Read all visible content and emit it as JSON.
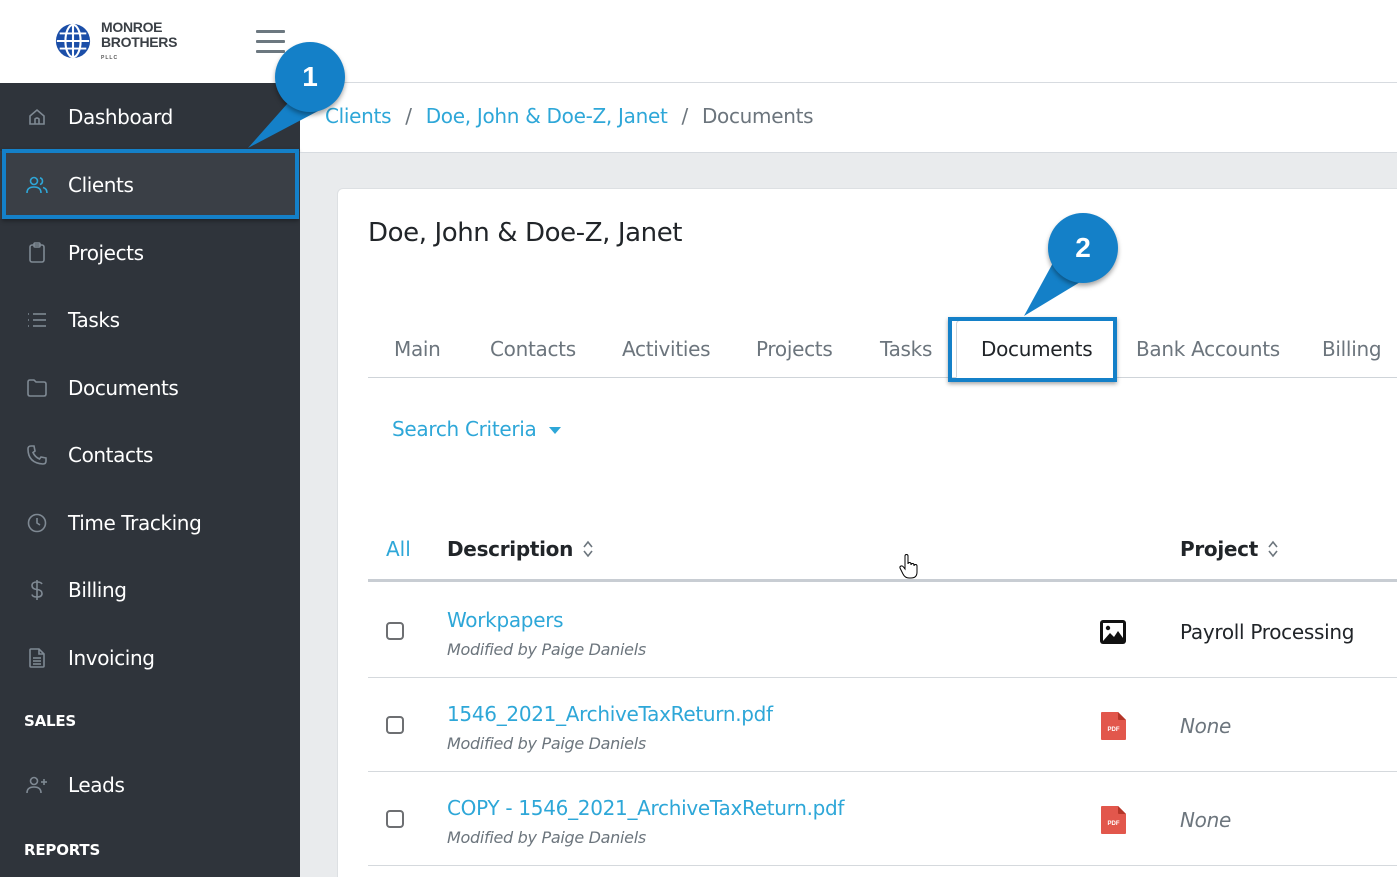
{
  "app": {
    "logo_line1": "MONROE",
    "logo_line2": "BROTHERS",
    "logo_sub": "PLLC",
    "brand_color": "#1b4ea8",
    "accent_color": "#2ea7d8",
    "callout_color": "#1480c8"
  },
  "sidebar": {
    "items": [
      {
        "label": "Dashboard",
        "icon": "home-icon"
      },
      {
        "label": "Clients",
        "icon": "users-icon",
        "active": true
      },
      {
        "label": "Projects",
        "icon": "clipboard-icon"
      },
      {
        "label": "Tasks",
        "icon": "list-icon"
      },
      {
        "label": "Documents",
        "icon": "folder-icon"
      },
      {
        "label": "Contacts",
        "icon": "phone-icon"
      },
      {
        "label": "Time Tracking",
        "icon": "clock-icon"
      },
      {
        "label": "Billing",
        "icon": "dollar-icon"
      },
      {
        "label": "Invoicing",
        "icon": "file-text-icon"
      }
    ],
    "sections": [
      {
        "label": "SALES",
        "items": [
          {
            "label": "Leads",
            "icon": "user-plus-icon"
          }
        ]
      },
      {
        "label": "REPORTS",
        "items": []
      }
    ]
  },
  "breadcrumb": {
    "items": [
      "Clients",
      "Doe, John & Doe-Z, Janet"
    ],
    "current": "Documents",
    "separator": "/"
  },
  "client": {
    "title": "Doe, John & Doe-Z, Janet"
  },
  "tabs": [
    {
      "label": "Main"
    },
    {
      "label": "Contacts"
    },
    {
      "label": "Activities"
    },
    {
      "label": "Projects"
    },
    {
      "label": "Tasks"
    },
    {
      "label": "Documents",
      "active": true
    },
    {
      "label": "Bank Accounts"
    },
    {
      "label": "Billing"
    }
  ],
  "search_criteria": {
    "label": "Search Criteria"
  },
  "table": {
    "select_all_label": "All",
    "columns": [
      "Description",
      "Project"
    ],
    "rows": [
      {
        "name": "Workpapers",
        "modified": "Modified by Paige Daniels",
        "type_icon": "image-icon",
        "project": "Payroll Processing",
        "checked": false
      },
      {
        "name": "1546_2021_ArchiveTaxReturn.pdf",
        "modified": "Modified by Paige Daniels",
        "type_icon": "pdf-icon",
        "project": "None",
        "checked": false
      },
      {
        "name": "COPY - 1546_2021_ArchiveTaxReturn.pdf",
        "modified": "Modified by Paige Daniels",
        "type_icon": "pdf-icon",
        "project": "None",
        "checked": false
      }
    ]
  },
  "pdf_icon_label": "PDF",
  "callouts": [
    {
      "number": "1",
      "target": "Clients"
    },
    {
      "number": "2",
      "target": "Documents tab"
    }
  ]
}
